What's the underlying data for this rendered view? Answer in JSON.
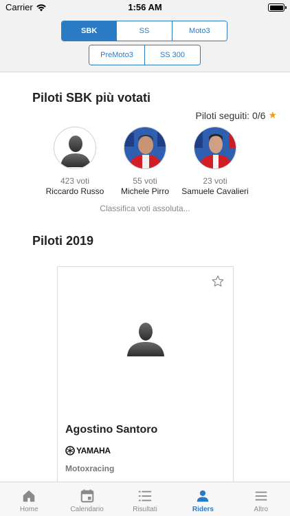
{
  "status_bar": {
    "carrier": "Carrier",
    "time": "1:56 AM"
  },
  "categories": {
    "row1": [
      {
        "label": "SBK",
        "active": true
      },
      {
        "label": "SS",
        "active": false
      },
      {
        "label": "Moto3",
        "active": false
      }
    ],
    "row2": [
      {
        "label": "PreMoto3",
        "active": false
      },
      {
        "label": "SS 300",
        "active": false
      }
    ]
  },
  "most_voted": {
    "title": "Piloti SBK più votati",
    "followed": "Piloti seguiti: 0/6",
    "riders": [
      {
        "votes": "423 voti",
        "name": "Riccardo Russo"
      },
      {
        "votes": "55 voti",
        "name": "Michele Pirro"
      },
      {
        "votes": "23 voti",
        "name": "Samuele Cavalieri"
      }
    ],
    "absolute_link": "Classifica voti assoluta..."
  },
  "riders_2019": {
    "title": "Piloti 2019",
    "card": {
      "name": "Agostino Santoro",
      "brand": "YAMAHA",
      "team": "Motoxracing"
    }
  },
  "tabs": [
    {
      "label": "Home",
      "icon": "home-icon"
    },
    {
      "label": "Calendario",
      "icon": "calendar-icon"
    },
    {
      "label": "Risultati",
      "icon": "list-icon"
    },
    {
      "label": "Riders",
      "icon": "person-icon"
    },
    {
      "label": "Altro",
      "icon": "menu-icon"
    }
  ],
  "colors": {
    "accent": "#2b7bc4",
    "star": "#f29b1d",
    "header_bg": "#f2f2f2"
  }
}
